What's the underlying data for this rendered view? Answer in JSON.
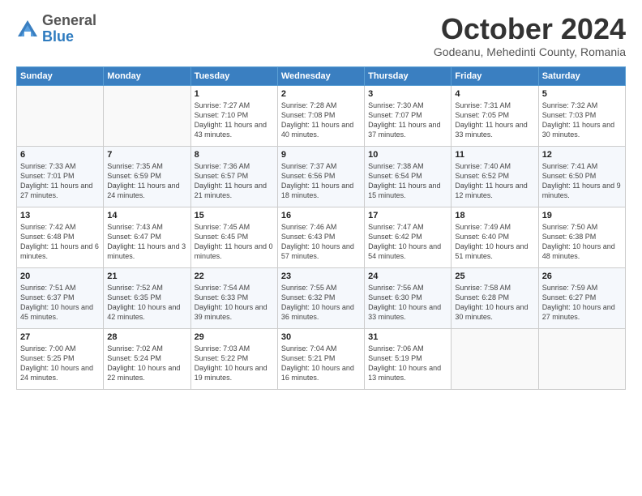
{
  "header": {
    "logo_general": "General",
    "logo_blue": "Blue",
    "month_title": "October 2024",
    "subtitle": "Godeanu, Mehedinti County, Romania"
  },
  "weekdays": [
    "Sunday",
    "Monday",
    "Tuesday",
    "Wednesday",
    "Thursday",
    "Friday",
    "Saturday"
  ],
  "weeks": [
    [
      {
        "day": "",
        "sunrise": "",
        "sunset": "",
        "daylight": ""
      },
      {
        "day": "",
        "sunrise": "",
        "sunset": "",
        "daylight": ""
      },
      {
        "day": "1",
        "sunrise": "Sunrise: 7:27 AM",
        "sunset": "Sunset: 7:10 PM",
        "daylight": "Daylight: 11 hours and 43 minutes."
      },
      {
        "day": "2",
        "sunrise": "Sunrise: 7:28 AM",
        "sunset": "Sunset: 7:08 PM",
        "daylight": "Daylight: 11 hours and 40 minutes."
      },
      {
        "day": "3",
        "sunrise": "Sunrise: 7:30 AM",
        "sunset": "Sunset: 7:07 PM",
        "daylight": "Daylight: 11 hours and 37 minutes."
      },
      {
        "day": "4",
        "sunrise": "Sunrise: 7:31 AM",
        "sunset": "Sunset: 7:05 PM",
        "daylight": "Daylight: 11 hours and 33 minutes."
      },
      {
        "day": "5",
        "sunrise": "Sunrise: 7:32 AM",
        "sunset": "Sunset: 7:03 PM",
        "daylight": "Daylight: 11 hours and 30 minutes."
      }
    ],
    [
      {
        "day": "6",
        "sunrise": "Sunrise: 7:33 AM",
        "sunset": "Sunset: 7:01 PM",
        "daylight": "Daylight: 11 hours and 27 minutes."
      },
      {
        "day": "7",
        "sunrise": "Sunrise: 7:35 AM",
        "sunset": "Sunset: 6:59 PM",
        "daylight": "Daylight: 11 hours and 24 minutes."
      },
      {
        "day": "8",
        "sunrise": "Sunrise: 7:36 AM",
        "sunset": "Sunset: 6:57 PM",
        "daylight": "Daylight: 11 hours and 21 minutes."
      },
      {
        "day": "9",
        "sunrise": "Sunrise: 7:37 AM",
        "sunset": "Sunset: 6:56 PM",
        "daylight": "Daylight: 11 hours and 18 minutes."
      },
      {
        "day": "10",
        "sunrise": "Sunrise: 7:38 AM",
        "sunset": "Sunset: 6:54 PM",
        "daylight": "Daylight: 11 hours and 15 minutes."
      },
      {
        "day": "11",
        "sunrise": "Sunrise: 7:40 AM",
        "sunset": "Sunset: 6:52 PM",
        "daylight": "Daylight: 11 hours and 12 minutes."
      },
      {
        "day": "12",
        "sunrise": "Sunrise: 7:41 AM",
        "sunset": "Sunset: 6:50 PM",
        "daylight": "Daylight: 11 hours and 9 minutes."
      }
    ],
    [
      {
        "day": "13",
        "sunrise": "Sunrise: 7:42 AM",
        "sunset": "Sunset: 6:48 PM",
        "daylight": "Daylight: 11 hours and 6 minutes."
      },
      {
        "day": "14",
        "sunrise": "Sunrise: 7:43 AM",
        "sunset": "Sunset: 6:47 PM",
        "daylight": "Daylight: 11 hours and 3 minutes."
      },
      {
        "day": "15",
        "sunrise": "Sunrise: 7:45 AM",
        "sunset": "Sunset: 6:45 PM",
        "daylight": "Daylight: 11 hours and 0 minutes."
      },
      {
        "day": "16",
        "sunrise": "Sunrise: 7:46 AM",
        "sunset": "Sunset: 6:43 PM",
        "daylight": "Daylight: 10 hours and 57 minutes."
      },
      {
        "day": "17",
        "sunrise": "Sunrise: 7:47 AM",
        "sunset": "Sunset: 6:42 PM",
        "daylight": "Daylight: 10 hours and 54 minutes."
      },
      {
        "day": "18",
        "sunrise": "Sunrise: 7:49 AM",
        "sunset": "Sunset: 6:40 PM",
        "daylight": "Daylight: 10 hours and 51 minutes."
      },
      {
        "day": "19",
        "sunrise": "Sunrise: 7:50 AM",
        "sunset": "Sunset: 6:38 PM",
        "daylight": "Daylight: 10 hours and 48 minutes."
      }
    ],
    [
      {
        "day": "20",
        "sunrise": "Sunrise: 7:51 AM",
        "sunset": "Sunset: 6:37 PM",
        "daylight": "Daylight: 10 hours and 45 minutes."
      },
      {
        "day": "21",
        "sunrise": "Sunrise: 7:52 AM",
        "sunset": "Sunset: 6:35 PM",
        "daylight": "Daylight: 10 hours and 42 minutes."
      },
      {
        "day": "22",
        "sunrise": "Sunrise: 7:54 AM",
        "sunset": "Sunset: 6:33 PM",
        "daylight": "Daylight: 10 hours and 39 minutes."
      },
      {
        "day": "23",
        "sunrise": "Sunrise: 7:55 AM",
        "sunset": "Sunset: 6:32 PM",
        "daylight": "Daylight: 10 hours and 36 minutes."
      },
      {
        "day": "24",
        "sunrise": "Sunrise: 7:56 AM",
        "sunset": "Sunset: 6:30 PM",
        "daylight": "Daylight: 10 hours and 33 minutes."
      },
      {
        "day": "25",
        "sunrise": "Sunrise: 7:58 AM",
        "sunset": "Sunset: 6:28 PM",
        "daylight": "Daylight: 10 hours and 30 minutes."
      },
      {
        "day": "26",
        "sunrise": "Sunrise: 7:59 AM",
        "sunset": "Sunset: 6:27 PM",
        "daylight": "Daylight: 10 hours and 27 minutes."
      }
    ],
    [
      {
        "day": "27",
        "sunrise": "Sunrise: 7:00 AM",
        "sunset": "Sunset: 5:25 PM",
        "daylight": "Daylight: 10 hours and 24 minutes."
      },
      {
        "day": "28",
        "sunrise": "Sunrise: 7:02 AM",
        "sunset": "Sunset: 5:24 PM",
        "daylight": "Daylight: 10 hours and 22 minutes."
      },
      {
        "day": "29",
        "sunrise": "Sunrise: 7:03 AM",
        "sunset": "Sunset: 5:22 PM",
        "daylight": "Daylight: 10 hours and 19 minutes."
      },
      {
        "day": "30",
        "sunrise": "Sunrise: 7:04 AM",
        "sunset": "Sunset: 5:21 PM",
        "daylight": "Daylight: 10 hours and 16 minutes."
      },
      {
        "day": "31",
        "sunrise": "Sunrise: 7:06 AM",
        "sunset": "Sunset: 5:19 PM",
        "daylight": "Daylight: 10 hours and 13 minutes."
      },
      {
        "day": "",
        "sunrise": "",
        "sunset": "",
        "daylight": ""
      },
      {
        "day": "",
        "sunrise": "",
        "sunset": "",
        "daylight": ""
      }
    ]
  ]
}
